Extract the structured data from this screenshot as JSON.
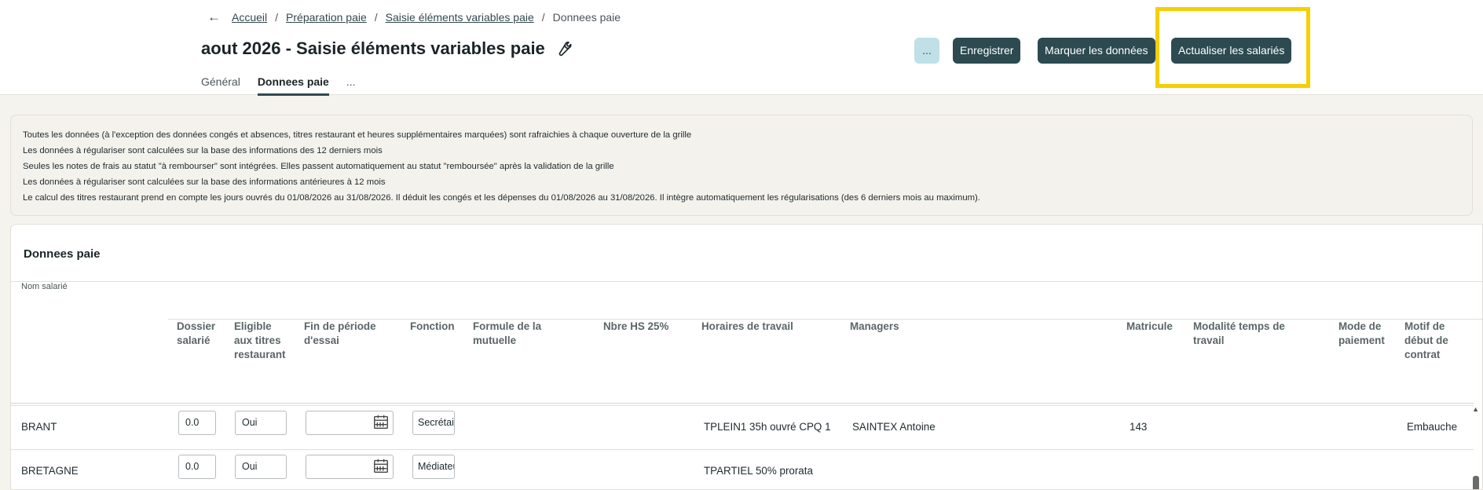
{
  "breadcrumb": {
    "back_icon": "arrow-left-icon",
    "items": [
      "Accueil",
      "Préparation paie",
      "Saisie éléments variables paie"
    ],
    "current": "Donnees paie",
    "separator": "/"
  },
  "page": {
    "title": "aout 2026 - Saisie éléments variables paie",
    "title_icon": "wrench-icon"
  },
  "tabs": [
    {
      "label": "Général",
      "active": false
    },
    {
      "label": "Donnees paie",
      "active": true
    },
    {
      "label": "...",
      "active": false
    }
  ],
  "toolbar": {
    "more_label": "...",
    "save_label": "Enregistrer",
    "mark_label": "Marquer les données",
    "refresh_label": "Actualiser les salariés"
  },
  "colors": {
    "primary": "#2c4a50",
    "light_button": "#bfe0e6",
    "highlight": "#f5cf00",
    "background": "#f5f3ee"
  },
  "info_lines": [
    "Toutes les données (à l'exception des données congés et absences, titres restaurant et heures supplémentaires marquées) sont rafraichies à chaque ouverture de la grille",
    "Les données à régulariser sont calculées sur la base des informations des 12 derniers mois",
    "Seules les notes de frais au statut \"à rembourser\" sont intégrées. Elles passent automatiquement au statut \"remboursée\" après la validation de la grille",
    "Les données à régulariser sont calculées sur la base des informations antérieures à 12 mois",
    "Le calcul des titres restaurant prend en compte les jours ouvrés du 01/08/2026 au 31/08/2026. Il déduit les congés et les dépenses du 01/08/2026 au 31/08/2026. Il intègre automatiquement les régularisations (des 6 derniers mois au maximum)."
  ],
  "grid": {
    "title": "Donnees paie",
    "name_column": "Nom salarié",
    "columns": [
      "Dossier salarié",
      "Eligible aux titres restaurant",
      "Fin de période d'essai",
      "Fonction",
      "Formule de la mutuelle",
      "Nbre HS 25%",
      "Horaires de travail",
      "Managers",
      "Matricule",
      "Modalité temps de travail",
      "Mode de paiement",
      "Motif de début de contrat"
    ],
    "rows": [
      {
        "name": "BRANT",
        "dossier": "0.0",
        "eligible": "Oui",
        "fin_essai": "",
        "fonction": "Secrétaire",
        "horaires": "TPLEIN1 35h ouvré CPQ 1",
        "managers": "SAINTEX Antoine",
        "matricule": "143",
        "motif": "Embauche"
      },
      {
        "name": "BRETAGNE",
        "dossier": "0.0",
        "eligible": "Oui",
        "fin_essai": "",
        "fonction": "Médiateur",
        "horaires": "TPARTIEL 50% prorata",
        "managers": "",
        "matricule": "",
        "motif": ""
      }
    ]
  }
}
